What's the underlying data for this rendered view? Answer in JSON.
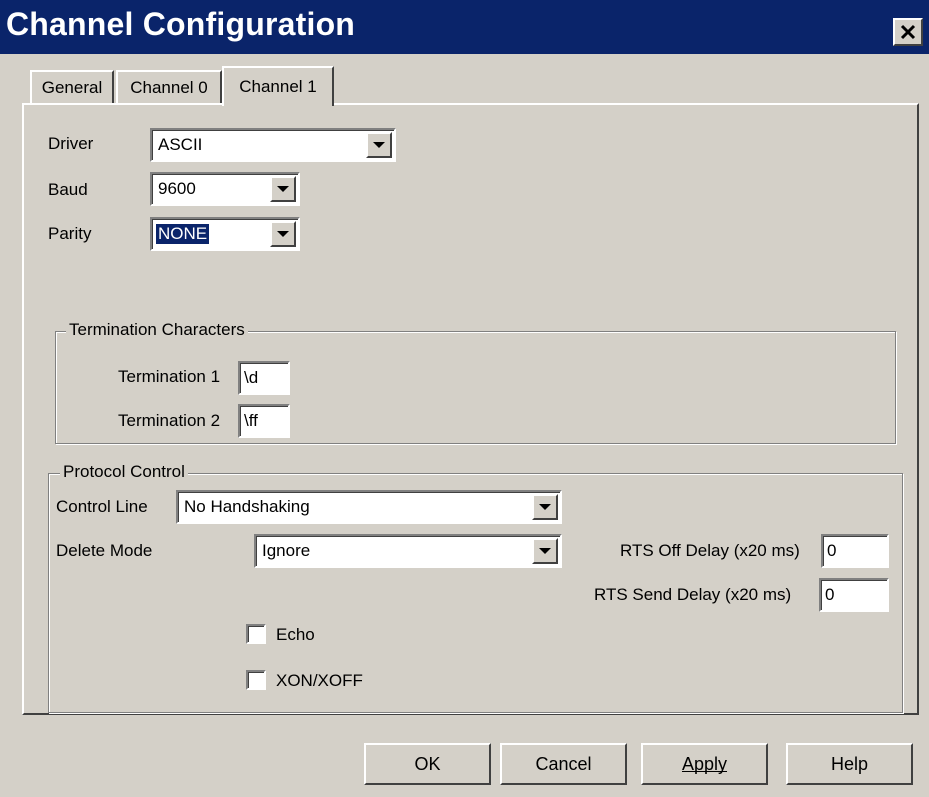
{
  "window": {
    "title": "Channel Configuration",
    "close_glyph": "✕"
  },
  "tabs": [
    {
      "label": "General",
      "active": false
    },
    {
      "label": "Channel 0",
      "active": false
    },
    {
      "label": "Channel 1",
      "active": true
    }
  ],
  "settings": {
    "driver": {
      "label": "Driver",
      "value": "ASCII"
    },
    "baud": {
      "label": "Baud",
      "value": "9600"
    },
    "parity": {
      "label": "Parity",
      "value": "NONE"
    }
  },
  "termination": {
    "title": "Termination Characters",
    "t1": {
      "label": "Termination 1",
      "value": "\\d"
    },
    "t2": {
      "label": "Termination 2",
      "value": "\\ff"
    }
  },
  "protocol": {
    "title": "Protocol Control",
    "control_line": {
      "label": "Control Line",
      "value": "No Handshaking"
    },
    "delete_mode": {
      "label": "Delete Mode",
      "value": "Ignore"
    },
    "rts_off": {
      "label": "RTS Off Delay (x20 ms)",
      "value": "0"
    },
    "rts_send": {
      "label": "RTS Send Delay (x20 ms)",
      "value": "0"
    },
    "echo": {
      "label": "Echo",
      "checked": false
    },
    "xonxoff": {
      "label": "XON/XOFF",
      "checked": false
    }
  },
  "buttons": {
    "ok": "OK",
    "cancel": "Cancel",
    "apply": "Apply",
    "help": "Help"
  },
  "colors": {
    "titlebar": "#0a246a",
    "face": "#d4d0c8",
    "selection": "#0a246a"
  }
}
